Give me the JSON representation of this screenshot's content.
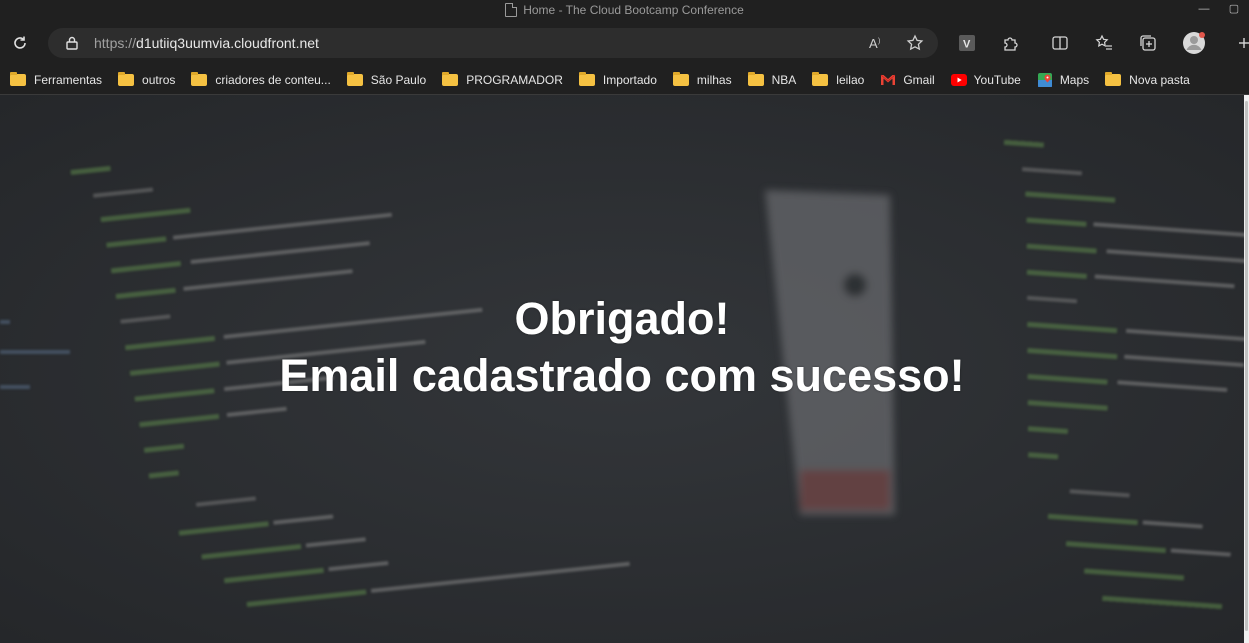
{
  "window": {
    "title": "Home - The Cloud Bootcamp Conference",
    "minimize_label": "—",
    "restore_label": "▢"
  },
  "address_bar": {
    "scheme": "https://",
    "host": "d1utiiq3uumvia.cloudfront.net"
  },
  "toolbar_icons": [
    "refresh-icon",
    "lock-icon",
    "read-aloud-icon",
    "favorite-star-icon",
    "extension-v-icon",
    "extensions-puzzle-icon",
    "split-screen-icon",
    "favorites-list-icon",
    "collections-icon",
    "profile-avatar-icon"
  ],
  "bookmarks": [
    {
      "label": "Ferramentas",
      "icon": "folder-icon"
    },
    {
      "label": "outros",
      "icon": "folder-icon"
    },
    {
      "label": "criadores de conteu...",
      "icon": "folder-icon"
    },
    {
      "label": "São Paulo",
      "icon": "folder-icon"
    },
    {
      "label": "PROGRAMADOR",
      "icon": "folder-icon"
    },
    {
      "label": "Importado",
      "icon": "folder-icon"
    },
    {
      "label": "milhas",
      "icon": "folder-icon"
    },
    {
      "label": "NBA",
      "icon": "folder-icon"
    },
    {
      "label": "leilao",
      "icon": "folder-icon"
    },
    {
      "label": "Gmail",
      "icon": "gmail-icon"
    },
    {
      "label": "YouTube",
      "icon": "youtube-icon"
    },
    {
      "label": "Maps",
      "icon": "maps-icon"
    },
    {
      "label": "Nova pasta",
      "icon": "folder-icon"
    }
  ],
  "hero": {
    "line1": "Obrigado!",
    "line2": "Email cadastrado com sucesso!"
  },
  "colors": {
    "browser_chrome": "#202020",
    "address_bar": "#2d2d2d",
    "page_background": "#2b2d30",
    "hero_text": "#ffffff",
    "folder": "#f5c142"
  }
}
